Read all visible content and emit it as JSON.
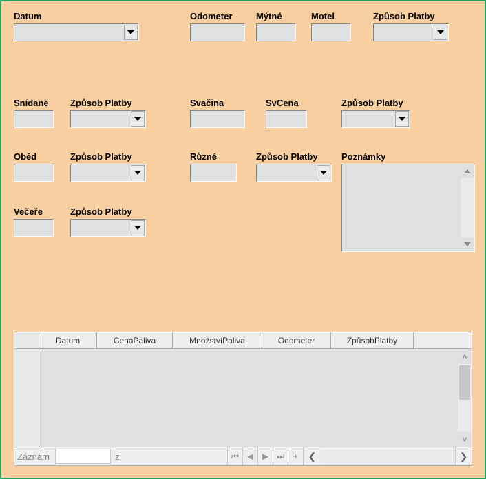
{
  "fields": {
    "datum_label": "Datum",
    "odometer_label": "Odometer",
    "mytne_label": "Mýtné",
    "motel_label": "Motel",
    "zpusob_platby_label": "Způsob Platby",
    "snidane_label": "Snídaně",
    "svacina_label": "Svačina",
    "svcena_label": "SvCena",
    "obed_label": "Oběd",
    "ruzne_label": "Různé",
    "poznamky_label": "Poznámky",
    "vecere_label": "Večeře"
  },
  "grid": {
    "columns": [
      "Datum",
      "CenaPaliva",
      "MnožstvíPaliva",
      "Odometer",
      "ZpůsobPlatby"
    ],
    "nav_label": "Záznam",
    "nav_of": "z"
  },
  "values": {
    "datum": "",
    "odometer": "",
    "mytne": "",
    "motel": "",
    "zpusob_platby_1": "",
    "snidane": "",
    "zpusob_platby_2": "",
    "svacina": "",
    "svcena": "",
    "zpusob_platby_3": "",
    "obed": "",
    "zpusob_platby_4": "",
    "ruzne": "",
    "zpusob_platby_5": "",
    "poznamky": "",
    "vecere": "",
    "zpusob_platby_6": "",
    "record_number": ""
  }
}
